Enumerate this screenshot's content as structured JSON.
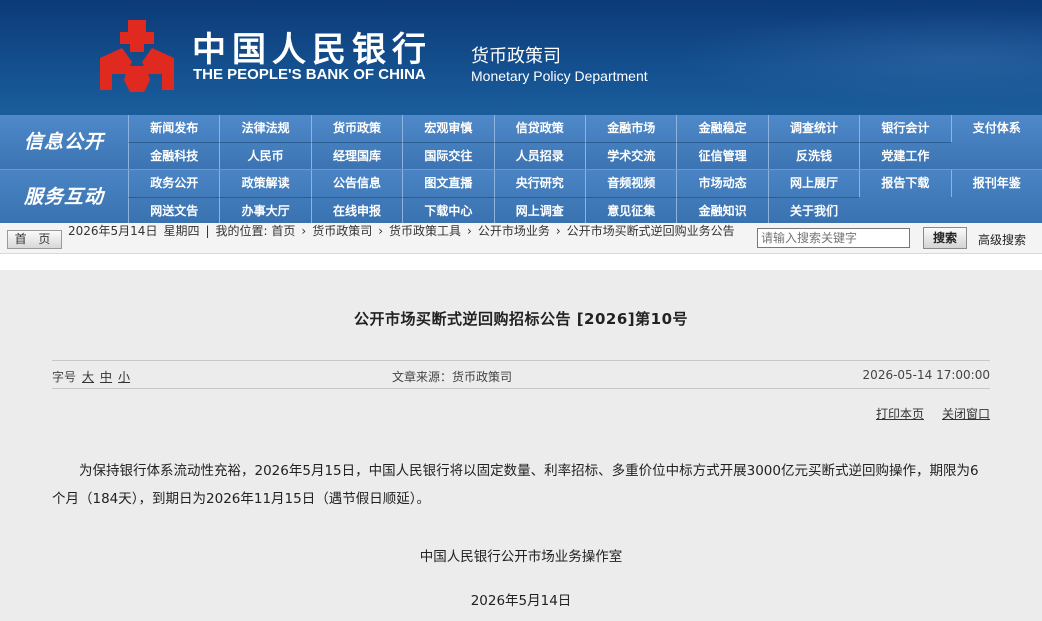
{
  "header": {
    "cn_name": "中国人民银行",
    "en_name": "THE PEOPLE'S BANK OF CHINA",
    "dept_cn": "货币政策司",
    "dept_en": "Monetary Policy Department",
    "logo_icon": "pboc-logo-icon",
    "logo_color": "#e02a1f"
  },
  "nav": {
    "group1_label": "信息公开",
    "group2_label": "服务互动",
    "group1_items": [
      "新闻发布",
      "法律法规",
      "货币政策",
      "宏观审慎",
      "信贷政策",
      "金融市场",
      "金融稳定",
      "调查统计",
      "银行会计",
      "支付体系",
      "金融科技",
      "人民币",
      "经理国库",
      "国际交往",
      "人员招录",
      "学术交流",
      "征信管理",
      "反洗钱",
      "党建工作"
    ],
    "group2_items": [
      "政务公开",
      "政策解读",
      "公告信息",
      "图文直播",
      "央行研究",
      "音频视频",
      "市场动态",
      "网上展厅",
      "报告下载",
      "报刊年鉴",
      "网送文告",
      "办事大厅",
      "在线申报",
      "下载中心",
      "网上调查",
      "意见征集",
      "金融知识",
      "关于我们"
    ]
  },
  "crumbbar": {
    "home_label": "首 页",
    "date": "2026年5月14日",
    "weekday": "星期四",
    "location_prefix": "我的位置: 首页",
    "crumbs": [
      "货币政策司",
      "货币政策工具",
      "公开市场业务",
      "公开市场买断式逆回购业务公告"
    ],
    "search_placeholder": "请输入搜索关键字",
    "search_button": "搜索",
    "advanced_search": "高级搜索"
  },
  "article": {
    "title": "公开市场买断式逆回购招标公告 [2026]第10号",
    "font_size_label": "字号",
    "font_sizes": [
      "大",
      "中",
      "小"
    ],
    "source": "文章来源：货币政策司",
    "publish_time": "2026-05-14 17:00:00",
    "print_label": "打印本页",
    "close_label": "关闭窗口",
    "body": "为保持银行体系流动性充裕，2026年5月15日，中国人民银行将以固定数量、利率招标、多重价位中标方式开展3000亿元买断式逆回购操作，期限为6个月（184天），到期日为2026年11月15日（遇节假日顺延）。",
    "signature": "中国人民银行公开市场业务操作室",
    "sign_date": "2026年5月14日"
  },
  "colors": {
    "banner": "#14508f",
    "nav": "#3f79bb",
    "content_bg": "#ececec"
  }
}
